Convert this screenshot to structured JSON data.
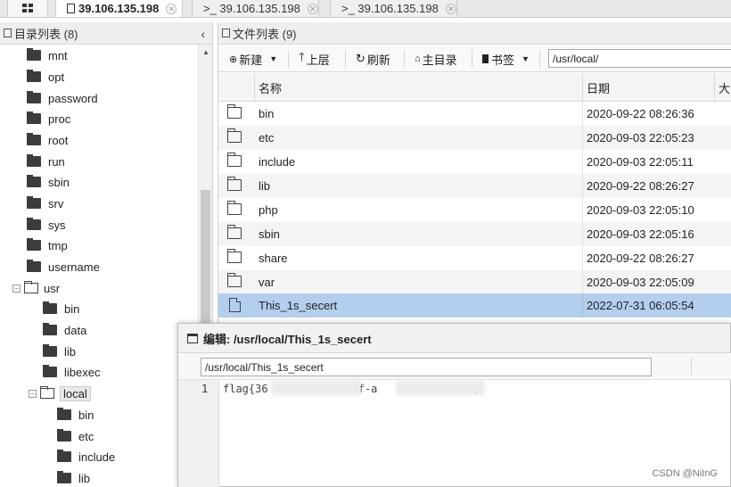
{
  "tabs": [
    {
      "label": "39.106.135.198",
      "active": true
    },
    {
      "label": ">_ 39.106.135.198",
      "active": false
    },
    {
      "label": ">_ 39.106.135.198",
      "active": false
    }
  ],
  "left_panel": {
    "title": "目录列表 (8)",
    "tree": [
      "mnt",
      "opt",
      "password",
      "proc",
      "root",
      "run",
      "sbin",
      "srv",
      "sys",
      "tmp",
      "username",
      "usr",
      "bin",
      "data",
      "lib",
      "libexec",
      "local",
      "bin",
      "etc",
      "include",
      "lib"
    ]
  },
  "right_panel": {
    "title": "文件列表 (9)",
    "toolbar": {
      "new_label": "新建",
      "up_label": "上层",
      "refresh_label": "刷新",
      "home_label": "主目录",
      "bookmark_label": "书签",
      "path_value": "/usr/local/"
    },
    "columns": {
      "name": "名称",
      "date": "日期",
      "size": "大"
    },
    "files": [
      {
        "name": "bin",
        "date": "2020-09-22 08:26:36",
        "type": "folder"
      },
      {
        "name": "etc",
        "date": "2020-09-03 22:05:23",
        "type": "folder"
      },
      {
        "name": "include",
        "date": "2020-09-03 22:05:11",
        "type": "folder"
      },
      {
        "name": "lib",
        "date": "2020-09-22 08:26:27",
        "type": "folder"
      },
      {
        "name": "php",
        "date": "2020-09-03 22:05:10",
        "type": "folder"
      },
      {
        "name": "sbin",
        "date": "2020-09-03 22:05:16",
        "type": "folder"
      },
      {
        "name": "share",
        "date": "2020-09-22 08:26:27",
        "type": "folder"
      },
      {
        "name": "var",
        "date": "2020-09-03 22:05:09",
        "type": "folder"
      },
      {
        "name": "This_1s_secert",
        "date": "2022-07-31 06:05:54",
        "type": "file"
      }
    ]
  },
  "editor": {
    "title": "编辑: /usr/local/This_1s_secert",
    "path_value": "/usr/local/This_1s_secert",
    "line_number": "1",
    "code_line": "flag{36            n9f-a           d60a}"
  },
  "watermark": "CSDN @NiInG",
  "colors": {
    "selected_row": "#b4cfee",
    "alt_row": "#f4f4f4"
  }
}
